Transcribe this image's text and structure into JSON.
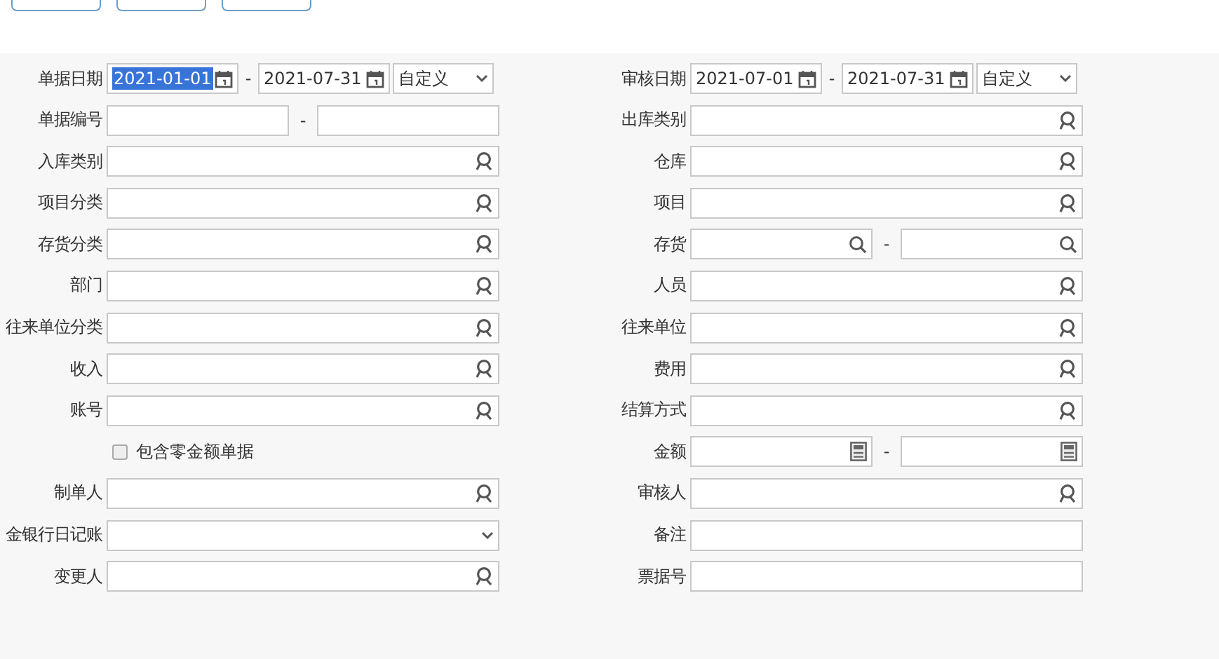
{
  "toolbar": {
    "buttons": [
      {
        "kind": "cut"
      },
      {
        "kind": "cut"
      },
      {
        "kind": "cut"
      }
    ]
  },
  "rows": [
    {
      "left": {
        "kind": "date-range",
        "label": "单据日期",
        "from": "2021-01-01",
        "from_selected": true,
        "to": "2021-07-31",
        "period": "自定义",
        "separator": "-"
      },
      "right": {
        "kind": "date-range",
        "label": "审核日期",
        "from": "2021-07-01",
        "from_selected": false,
        "to": "2021-07-31",
        "period": "自定义",
        "separator": "-"
      }
    },
    {
      "left": {
        "kind": "range",
        "label": "单据编号",
        "separator": "-"
      },
      "right": {
        "kind": "lookup",
        "label": "出库类别"
      }
    },
    {
      "left": {
        "kind": "lookup",
        "label": "入库类别"
      },
      "right": {
        "kind": "lookup",
        "label": "仓库"
      }
    },
    {
      "left": {
        "kind": "lookup",
        "label": "项目分类"
      },
      "right": {
        "kind": "lookup",
        "label": "项目"
      }
    },
    {
      "left": {
        "kind": "lookup",
        "label": "存货分类"
      },
      "right": {
        "kind": "search-range",
        "label": "存货",
        "separator": "-"
      }
    },
    {
      "left": {
        "kind": "lookup",
        "label": "部门"
      },
      "right": {
        "kind": "lookup",
        "label": "人员"
      }
    },
    {
      "left": {
        "kind": "lookup",
        "label": "往来单位分类"
      },
      "right": {
        "kind": "lookup",
        "label": "往来单位"
      }
    },
    {
      "left": {
        "kind": "lookup",
        "label": "收入"
      },
      "right": {
        "kind": "lookup",
        "label": "费用"
      }
    },
    {
      "left": {
        "kind": "lookup",
        "label": "账号"
      },
      "right": {
        "kind": "lookup",
        "label": "结算方式"
      }
    },
    {
      "left": {
        "kind": "checkbox",
        "label": "包含零金额单据",
        "checked": false
      },
      "right": {
        "kind": "amount-range",
        "label": "金额",
        "separator": "-"
      }
    },
    {
      "left": {
        "kind": "lookup",
        "label": "制单人"
      },
      "right": {
        "kind": "lookup",
        "label": "审核人"
      }
    },
    {
      "left": {
        "kind": "select",
        "label": "金银行日记账"
      },
      "right": {
        "kind": "text",
        "label": "备注"
      }
    },
    {
      "left": {
        "kind": "lookup",
        "label": "变更人"
      },
      "right": {
        "kind": "text",
        "label": "票据号"
      }
    }
  ]
}
